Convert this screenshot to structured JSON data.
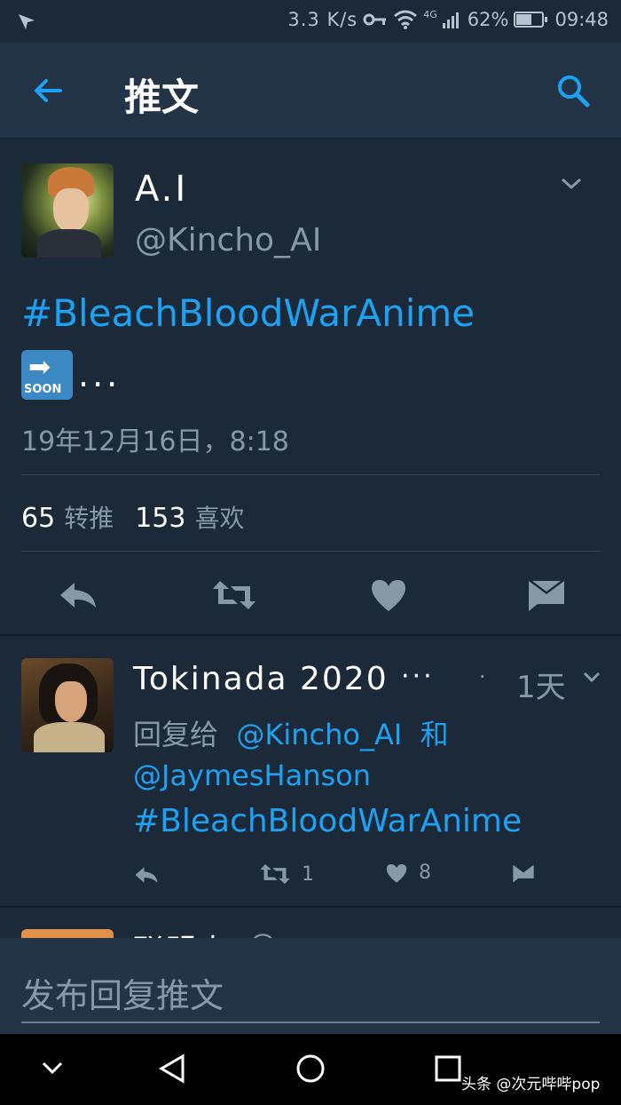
{
  "status_bar": {
    "speed": "3.3 K/s",
    "network": "4G",
    "battery": "62%",
    "time": "09:48",
    "battery_level": 0.62
  },
  "app_bar": {
    "title": "推文"
  },
  "tweet": {
    "name": "A.I",
    "handle": "@Kincho_AI",
    "hashtag": "#BleachBloodWarAnime",
    "emoji_label": "SOON",
    "ellipsis": "...",
    "timestamp": "19年12月16日，8:18",
    "retweet_count": "65",
    "retweet_label": "转推",
    "like_count": "153",
    "like_label": "喜欢"
  },
  "reply": {
    "name": "Tokinada 2020",
    "more": "···",
    "dot": "·",
    "time": "1天",
    "reply_prefix": "回复给",
    "mention1": "@Kincho_AI",
    "and": "和",
    "mention2": "@JaymesHanson",
    "hashtag": "#BleachBloodWarAnime",
    "retweets": "1",
    "likes": "8"
  },
  "peek": {
    "name": "联盟寺",
    "meta": "@..."
  },
  "compose": {
    "placeholder": "发布回复推文"
  },
  "watermark": "头条 @次元哔哔pop",
  "colors": {
    "background": "#1c2938",
    "bar": "#243447",
    "accent": "#1da1f2",
    "secondary": "#8899a6"
  }
}
